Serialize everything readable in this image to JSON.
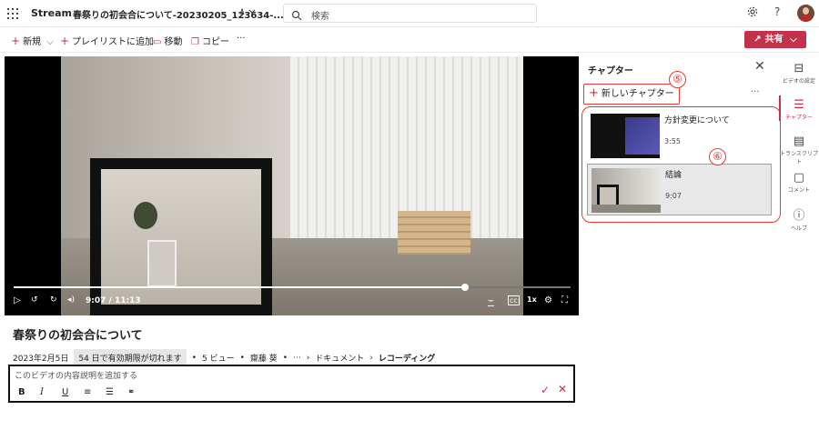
{
  "topbar": {
    "app_name": "Stream",
    "doc_title": "春祭りの初会合について-20230205_123634-...",
    "search_placeholder": "検索"
  },
  "commands": {
    "new": "新規",
    "add_playlist": "プレイリストに追加",
    "move": "移動",
    "copy": "コピー",
    "more": "···",
    "share": "共有"
  },
  "video": {
    "current_time": "9:07",
    "duration": "11:13",
    "separator": " / ",
    "speed": "1x",
    "progress": 0.81
  },
  "details": {
    "title": "春祭りの初会合について",
    "date": "2023年2月5日",
    "expiry": "54 日で有効期限が切れます",
    "views": "5 ビュー",
    "author": "齋藤 葵",
    "ellipsis": "···",
    "breadcrumb_parent": "ドキュメント",
    "breadcrumb_current": "レコーディング",
    "description_placeholder": "このビデオの内容説明を追加する"
  },
  "chapters": {
    "title": "チャプター",
    "new_chapter": "新しいチャプター",
    "callout_new": "⑤",
    "callout_list": "⑥",
    "items": [
      {
        "name": "方針変更について",
        "time": "3:55"
      },
      {
        "name": "結論",
        "time": "9:07"
      }
    ]
  },
  "rail": {
    "items": [
      {
        "label": "ビデオの設定"
      },
      {
        "label": "チャプター"
      },
      {
        "label": "トランスクリプト"
      },
      {
        "label": "コメント"
      },
      {
        "label": "ヘルプ"
      }
    ]
  },
  "colors": {
    "accent": "#c4314b",
    "annotation": "#e53935"
  }
}
